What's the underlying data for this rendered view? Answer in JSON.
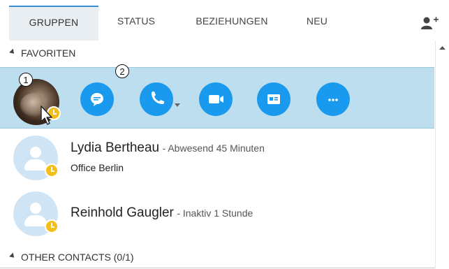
{
  "tabs": [
    {
      "label": "GRUPPEN",
      "active": true
    },
    {
      "label": "STATUS",
      "active": false
    },
    {
      "label": "BEZIEHUNGEN",
      "active": false
    },
    {
      "label": "NEU",
      "active": false
    }
  ],
  "toolbar": {
    "add_contact_icon": "add-contact-icon"
  },
  "groups": {
    "favorites": {
      "label": "FAVORITEN"
    },
    "other": {
      "label": "OTHER CONTACTS (0/1)"
    }
  },
  "favorite_row": {
    "callouts": [
      "1",
      "2"
    ],
    "actions": [
      "instant-message",
      "call",
      "video-call",
      "contact-card",
      "more-options"
    ],
    "presence": "away"
  },
  "contacts": [
    {
      "name": "Lydia Bertheau",
      "status": "- Abwesend 45 Minuten",
      "location": "Office Berlin",
      "presence": "away"
    },
    {
      "name": "Reinhold Gaugler",
      "status": "- Inaktiv 1 Stunde",
      "location": "",
      "presence": "away"
    }
  ],
  "colors": {
    "accent": "#1a9aee",
    "selected_row": "#bcdeef",
    "away": "#f4bd1a",
    "tab_active": "#e9eef3"
  }
}
